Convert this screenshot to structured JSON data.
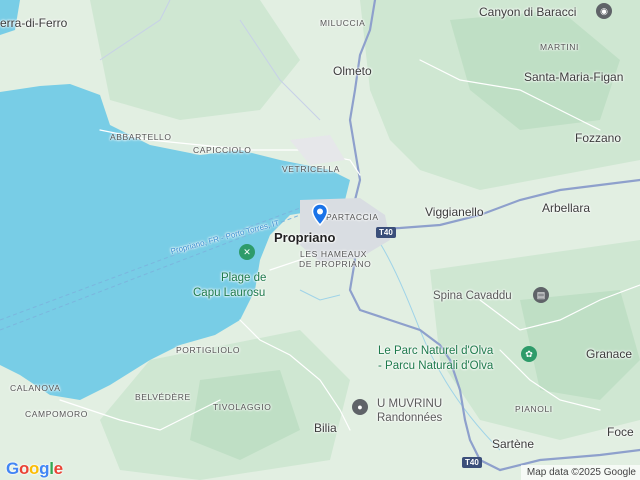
{
  "labels": {
    "serra": "erra-di-Ferro",
    "miluccia": "MILUCCIA",
    "olmeto": "Olmeto",
    "canyon": "Canyon di Baracci",
    "martini": "MARTINI",
    "santa_maria": "Santa-Maria-Figan",
    "abbartello": "ABBARTELLO",
    "capicciolo": "CAPICCIOLO",
    "fozzano": "Fozzano",
    "vetricella": "VETRICELLA",
    "partaccia": "PARTACCIA",
    "viggianello": "Viggianello",
    "arbellara": "Arbellara",
    "propriano": "Propriano",
    "hameaux_1": "LES HAMEAUX",
    "hameaux_2": "DE PROPRIANO",
    "ferry": "Propriano, FR - Porto Torres, IT",
    "plage_1": "Plage de",
    "plage_2": "Capu Laurosu",
    "spina": "Spina Cavaddu",
    "portigliolo": "PORTIGLIOLO",
    "parc_1": "Le Parc Naturel d'Olva",
    "parc_2": "- Parcu Naturali d'Olva",
    "granace": "Granace",
    "calanova": "CALANOVA",
    "belvedere": "BELVÉDÈRE",
    "umuvrinu_1": "U MUVRINU",
    "umuvrinu_2": "Randonnées",
    "campomoro": "CAMPOMORO",
    "tivolaggio": "TIVOLAGGIO",
    "pianoli": "PIANOLI",
    "bilia": "Bilia",
    "foce": "Foce",
    "sartene": "Sartène"
  },
  "road_shields": {
    "t40_a": "T40",
    "t40_b": "T40"
  },
  "branding": {
    "logo": "Google",
    "attribution": "Map data ©2025 Google"
  },
  "colors": {
    "water": "#78cde6",
    "land": "#e2efe2",
    "forest": "#c9e5cd",
    "road": "#7a8fc0",
    "poi_green": "#2e9b6a"
  }
}
